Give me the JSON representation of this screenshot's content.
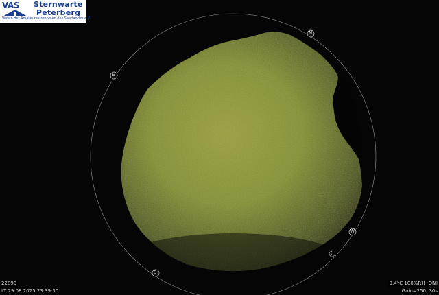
{
  "logo": {
    "abbr": "VAS",
    "name_line1": "Sternwarte",
    "name_line2": "Peterberg",
    "subtitle": "Verein der Amateurastronomen des Saarlandes e.V.",
    "brand_color": "#1b3f8f"
  },
  "compass": {
    "north": "N",
    "east": "E",
    "south": "S",
    "west": "W"
  },
  "overlay": {
    "frame_number": "22893",
    "local_time": "LT 29.08.2025 23:39:30",
    "temperature_humidity": "9.4°C 100%RH [ON]",
    "gain": "Gain=250",
    "exposure": "30s"
  },
  "colors": {
    "sky_glow": "#7a8a2e",
    "sky_center": "#8f9a3a",
    "background": "#050505"
  }
}
